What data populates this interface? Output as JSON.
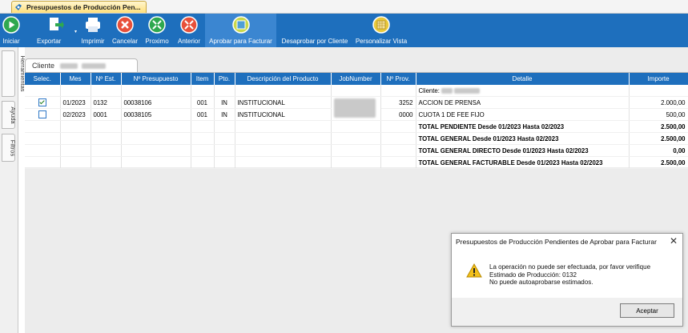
{
  "window_tab": {
    "title": "Presupuestos de Producción Pen..."
  },
  "toolbar": [
    {
      "label": "Iniciar",
      "icon": "play-icon",
      "color": "#2fa84f"
    },
    {
      "label": "Exportar",
      "icon": "export-icon",
      "color": "#ffffff"
    },
    {
      "label": "Imprimir",
      "icon": "printer-icon",
      "color": "#ffffff"
    },
    {
      "label": "Cancelar",
      "icon": "cancel-icon",
      "color": "#e8503a"
    },
    {
      "label": "Proximo",
      "icon": "next-icon",
      "color": "#2fa84f"
    },
    {
      "label": "Anterior",
      "icon": "previous-icon",
      "color": "#e8503a"
    },
    {
      "label": "Aprobar para Facturar",
      "icon": "approve-invoice-icon",
      "color": "#c9d84a"
    },
    {
      "label": "Desaprobar por Cliente",
      "icon": "disapprove-icon",
      "color": "#ffffff"
    },
    {
      "label": "Personalizar Vista",
      "icon": "customize-view-icon",
      "color": "#e9c93b"
    }
  ],
  "sidebar": {
    "tabs": [
      "Herramientas",
      "Ayuda",
      "Filtros"
    ]
  },
  "client_tab": {
    "label": "Cliente"
  },
  "grid": {
    "columns": [
      "Selec.",
      "Mes",
      "Nº Est.",
      "Nº Presupuesto",
      "Item",
      "Pto.",
      "Descripción del Producto",
      "JobNumber",
      "Nº Prov.",
      "Detalle",
      "Importe"
    ],
    "client_row_label": "Cliente:",
    "rows": [
      {
        "checked": true,
        "mes": "01/2023",
        "est": "0132",
        "presupuesto": "00038106",
        "item": "001",
        "pto": "IN",
        "descripcion": "INSTITUCIONAL",
        "prov": "3252",
        "detalle": "ACCION DE PRENSA",
        "importe": "2.000,00"
      },
      {
        "checked": false,
        "mes": "02/2023",
        "est": "0001",
        "presupuesto": "00038105",
        "item": "001",
        "pto": "IN",
        "descripcion": "INSTITUCIONAL",
        "prov": "0000",
        "detalle": "CUOTA 1 DE FEE FIJO",
        "importe": "500,00"
      }
    ],
    "totals": [
      {
        "label": "TOTAL PENDIENTE Desde 01/2023 Hasta 02/2023",
        "value": "2.500,00"
      },
      {
        "label": "TOTAL GENERAL Desde 01/2023 Hasta 02/2023",
        "value": "2.500,00"
      },
      {
        "label": "TOTAL GENERAL DIRECTO Desde 01/2023 Hasta 02/2023",
        "value": "0,00"
      },
      {
        "label": "TOTAL GENERAL FACTURABLE Desde 01/2023 Hasta 02/2023",
        "value": "2.500,00"
      }
    ]
  },
  "dialog": {
    "title": "Presupuestos de Producción Pendientes de Aprobar para Facturar",
    "lines": [
      "La operación no puede ser efectuada, por favor verifique",
      "Estimado de Producción: 0132",
      "No puede autoaprobarse estimados."
    ],
    "ok_label": "Aceptar"
  }
}
